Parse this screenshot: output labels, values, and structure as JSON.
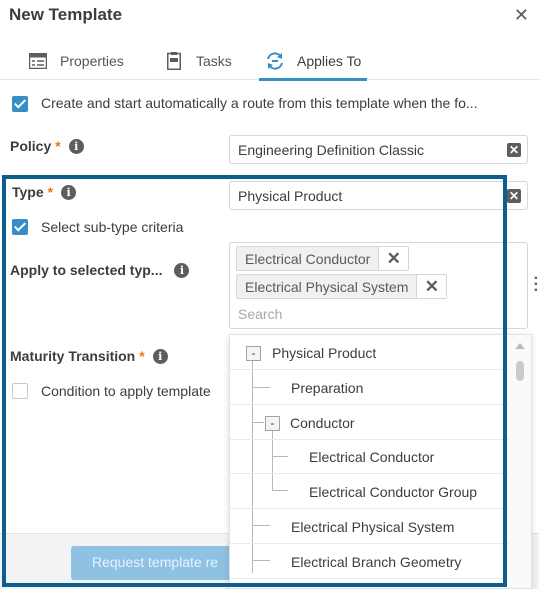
{
  "dialog": {
    "title": "New Template",
    "close_glyph": "✕"
  },
  "tabs": [
    {
      "label": "Properties",
      "icon": "properties-icon",
      "active": false
    },
    {
      "label": "Tasks",
      "icon": "tasks-icon",
      "active": false
    },
    {
      "label": "Applies To",
      "icon": "applies-to-icon",
      "active": true
    }
  ],
  "auto_route": {
    "checked": true,
    "label": "Create and start automatically a route from this template when the fo..."
  },
  "policy": {
    "label": "Policy",
    "required_mark": "*",
    "value": "Engineering Definition Classic"
  },
  "type": {
    "label": "Type",
    "required_mark": "*",
    "value": "Physical Product"
  },
  "subtype": {
    "checked": true,
    "label": "Select sub-type criteria"
  },
  "apply_to": {
    "label": "Apply to selected typ...",
    "tags": [
      "Electrical Conductor",
      "Electrical Physical System"
    ],
    "search_placeholder": "Search"
  },
  "maturity": {
    "label": "Maturity Transition",
    "required_mark": "*"
  },
  "condition": {
    "checked": false,
    "label": "Condition to apply template"
  },
  "tree": {
    "items": [
      {
        "label": "Physical Product",
        "level": 0,
        "expander": "-"
      },
      {
        "label": "Preparation",
        "level": 1
      },
      {
        "label": "Conductor",
        "level": 1,
        "expander": "-"
      },
      {
        "label": "Electrical Conductor",
        "level": 2
      },
      {
        "label": "Electrical Conductor Group",
        "level": 2
      },
      {
        "label": "Electrical Physical System",
        "level": 1
      },
      {
        "label": "Electrical Branch Geometry",
        "level": 1
      }
    ]
  },
  "footer": {
    "request_button": "Request template re"
  },
  "colors": {
    "accent": "#368ec4",
    "highlight_border": "#0b5e8e",
    "required": "#e87511",
    "button_disabled": "#8fc1e3"
  }
}
